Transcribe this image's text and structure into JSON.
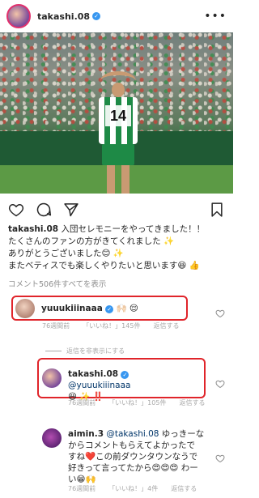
{
  "post": {
    "username": "takashi.08",
    "more_icon": "more-dots-icon"
  },
  "caption": {
    "username": "takashi.08",
    "line1": "入団セレモニーをやってきました！！",
    "line2": "たくさんのファンの方がきてくれました ✨",
    "line3": "ありがとうございました😊 ✨",
    "line4": "またベティスでも楽しくやりたいと思います😆 👍"
  },
  "view_all_comments": "コメント506件すべてを表示",
  "comments": [
    {
      "username": "yuuukiiinaaa",
      "text": "🙌🏻 😌",
      "time": "76週間前",
      "likes": "「いいね！」145件",
      "reply": "返信する"
    },
    {
      "username": "takashi.08",
      "mention": "@yuuukiiinaaa",
      "text": "😆 ✨ ‼️",
      "time": "76週間前",
      "likes": "「いいね！」105件",
      "reply": "返信する"
    },
    {
      "username": "aimin.3",
      "mention": "@takashi.08",
      "text": " ゆっきーな からコメントもらえてよかったで すね❤️この前ダウンタウンなうで 好きって言ってたから😍😍😍 わーい😁🙌",
      "time": "76週間前",
      "likes": "「いいね！」4件",
      "reply": "返信する"
    }
  ],
  "hide_replies": "返信を非表示にする",
  "colors": {
    "highlight": "#e0242a",
    "verified": "#3897f0",
    "muted": "#8e8e8e"
  }
}
